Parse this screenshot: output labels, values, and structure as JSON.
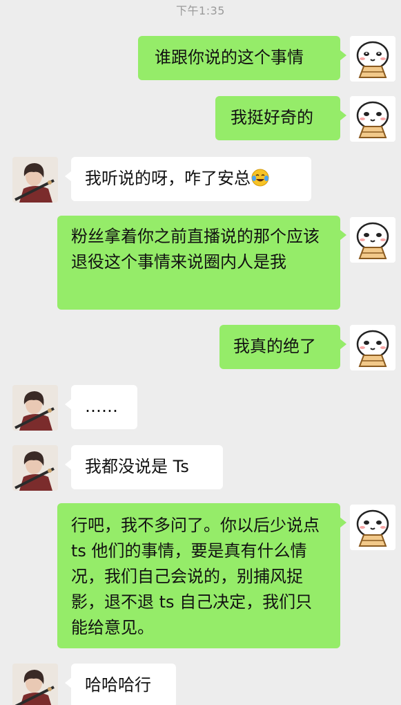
{
  "status_time": "下午1:35",
  "messages": [
    {
      "side": "out",
      "text": "谁跟你说的这个事情"
    },
    {
      "side": "out",
      "text": "我挺好奇的"
    },
    {
      "side": "in",
      "text": "我听说的呀，咋了安总",
      "emoji": "face-with-tears-of-joy"
    },
    {
      "side": "out",
      "text": "粉丝拿着你之前直播说的那个应该退役这个事情来说圈内人是我"
    },
    {
      "side": "out",
      "text": "我真的绝了"
    },
    {
      "side": "in",
      "text": "……"
    },
    {
      "side": "in",
      "text": "我都没说是 Ts"
    },
    {
      "side": "out",
      "text": "行吧，我不多问了。你以后少说点 ts 他们的事情，要是真有什么情况，我们自己会说的，别捕风捉影，退不退 ts 自己决定，我们只能给意见。"
    },
    {
      "side": "in",
      "text": "哈哈哈行"
    }
  ],
  "colors": {
    "background": "#ededed",
    "outgoing_bubble": "#95ec69",
    "incoming_bubble": "#ffffff",
    "time_text": "#9a9a9a"
  },
  "icons": {
    "self_avatar": "cartoon-face-avatar-icon",
    "other_avatar": "illustrated-person-avatar-icon"
  }
}
